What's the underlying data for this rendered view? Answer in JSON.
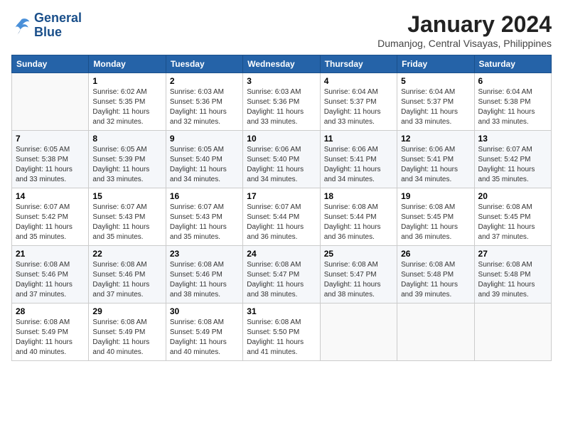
{
  "logo": {
    "line1": "General",
    "line2": "Blue"
  },
  "title": "January 2024",
  "location": "Dumanjog, Central Visayas, Philippines",
  "weekdays": [
    "Sunday",
    "Monday",
    "Tuesday",
    "Wednesday",
    "Thursday",
    "Friday",
    "Saturday"
  ],
  "weeks": [
    [
      {
        "day": "",
        "sunrise": "",
        "sunset": "",
        "daylight": ""
      },
      {
        "day": "1",
        "sunrise": "Sunrise: 6:02 AM",
        "sunset": "Sunset: 5:35 PM",
        "daylight": "Daylight: 11 hours and 32 minutes."
      },
      {
        "day": "2",
        "sunrise": "Sunrise: 6:03 AM",
        "sunset": "Sunset: 5:36 PM",
        "daylight": "Daylight: 11 hours and 32 minutes."
      },
      {
        "day": "3",
        "sunrise": "Sunrise: 6:03 AM",
        "sunset": "Sunset: 5:36 PM",
        "daylight": "Daylight: 11 hours and 33 minutes."
      },
      {
        "day": "4",
        "sunrise": "Sunrise: 6:04 AM",
        "sunset": "Sunset: 5:37 PM",
        "daylight": "Daylight: 11 hours and 33 minutes."
      },
      {
        "day": "5",
        "sunrise": "Sunrise: 6:04 AM",
        "sunset": "Sunset: 5:37 PM",
        "daylight": "Daylight: 11 hours and 33 minutes."
      },
      {
        "day": "6",
        "sunrise": "Sunrise: 6:04 AM",
        "sunset": "Sunset: 5:38 PM",
        "daylight": "Daylight: 11 hours and 33 minutes."
      }
    ],
    [
      {
        "day": "7",
        "sunrise": "Sunrise: 6:05 AM",
        "sunset": "Sunset: 5:38 PM",
        "daylight": "Daylight: 11 hours and 33 minutes."
      },
      {
        "day": "8",
        "sunrise": "Sunrise: 6:05 AM",
        "sunset": "Sunset: 5:39 PM",
        "daylight": "Daylight: 11 hours and 33 minutes."
      },
      {
        "day": "9",
        "sunrise": "Sunrise: 6:05 AM",
        "sunset": "Sunset: 5:40 PM",
        "daylight": "Daylight: 11 hours and 34 minutes."
      },
      {
        "day": "10",
        "sunrise": "Sunrise: 6:06 AM",
        "sunset": "Sunset: 5:40 PM",
        "daylight": "Daylight: 11 hours and 34 minutes."
      },
      {
        "day": "11",
        "sunrise": "Sunrise: 6:06 AM",
        "sunset": "Sunset: 5:41 PM",
        "daylight": "Daylight: 11 hours and 34 minutes."
      },
      {
        "day": "12",
        "sunrise": "Sunrise: 6:06 AM",
        "sunset": "Sunset: 5:41 PM",
        "daylight": "Daylight: 11 hours and 34 minutes."
      },
      {
        "day": "13",
        "sunrise": "Sunrise: 6:07 AM",
        "sunset": "Sunset: 5:42 PM",
        "daylight": "Daylight: 11 hours and 35 minutes."
      }
    ],
    [
      {
        "day": "14",
        "sunrise": "Sunrise: 6:07 AM",
        "sunset": "Sunset: 5:42 PM",
        "daylight": "Daylight: 11 hours and 35 minutes."
      },
      {
        "day": "15",
        "sunrise": "Sunrise: 6:07 AM",
        "sunset": "Sunset: 5:43 PM",
        "daylight": "Daylight: 11 hours and 35 minutes."
      },
      {
        "day": "16",
        "sunrise": "Sunrise: 6:07 AM",
        "sunset": "Sunset: 5:43 PM",
        "daylight": "Daylight: 11 hours and 35 minutes."
      },
      {
        "day": "17",
        "sunrise": "Sunrise: 6:07 AM",
        "sunset": "Sunset: 5:44 PM",
        "daylight": "Daylight: 11 hours and 36 minutes."
      },
      {
        "day": "18",
        "sunrise": "Sunrise: 6:08 AM",
        "sunset": "Sunset: 5:44 PM",
        "daylight": "Daylight: 11 hours and 36 minutes."
      },
      {
        "day": "19",
        "sunrise": "Sunrise: 6:08 AM",
        "sunset": "Sunset: 5:45 PM",
        "daylight": "Daylight: 11 hours and 36 minutes."
      },
      {
        "day": "20",
        "sunrise": "Sunrise: 6:08 AM",
        "sunset": "Sunset: 5:45 PM",
        "daylight": "Daylight: 11 hours and 37 minutes."
      }
    ],
    [
      {
        "day": "21",
        "sunrise": "Sunrise: 6:08 AM",
        "sunset": "Sunset: 5:46 PM",
        "daylight": "Daylight: 11 hours and 37 minutes."
      },
      {
        "day": "22",
        "sunrise": "Sunrise: 6:08 AM",
        "sunset": "Sunset: 5:46 PM",
        "daylight": "Daylight: 11 hours and 37 minutes."
      },
      {
        "day": "23",
        "sunrise": "Sunrise: 6:08 AM",
        "sunset": "Sunset: 5:46 PM",
        "daylight": "Daylight: 11 hours and 38 minutes."
      },
      {
        "day": "24",
        "sunrise": "Sunrise: 6:08 AM",
        "sunset": "Sunset: 5:47 PM",
        "daylight": "Daylight: 11 hours and 38 minutes."
      },
      {
        "day": "25",
        "sunrise": "Sunrise: 6:08 AM",
        "sunset": "Sunset: 5:47 PM",
        "daylight": "Daylight: 11 hours and 38 minutes."
      },
      {
        "day": "26",
        "sunrise": "Sunrise: 6:08 AM",
        "sunset": "Sunset: 5:48 PM",
        "daylight": "Daylight: 11 hours and 39 minutes."
      },
      {
        "day": "27",
        "sunrise": "Sunrise: 6:08 AM",
        "sunset": "Sunset: 5:48 PM",
        "daylight": "Daylight: 11 hours and 39 minutes."
      }
    ],
    [
      {
        "day": "28",
        "sunrise": "Sunrise: 6:08 AM",
        "sunset": "Sunset: 5:49 PM",
        "daylight": "Daylight: 11 hours and 40 minutes."
      },
      {
        "day": "29",
        "sunrise": "Sunrise: 6:08 AM",
        "sunset": "Sunset: 5:49 PM",
        "daylight": "Daylight: 11 hours and 40 minutes."
      },
      {
        "day": "30",
        "sunrise": "Sunrise: 6:08 AM",
        "sunset": "Sunset: 5:49 PM",
        "daylight": "Daylight: 11 hours and 40 minutes."
      },
      {
        "day": "31",
        "sunrise": "Sunrise: 6:08 AM",
        "sunset": "Sunset: 5:50 PM",
        "daylight": "Daylight: 11 hours and 41 minutes."
      },
      {
        "day": "",
        "sunrise": "",
        "sunset": "",
        "daylight": ""
      },
      {
        "day": "",
        "sunrise": "",
        "sunset": "",
        "daylight": ""
      },
      {
        "day": "",
        "sunrise": "",
        "sunset": "",
        "daylight": ""
      }
    ]
  ]
}
